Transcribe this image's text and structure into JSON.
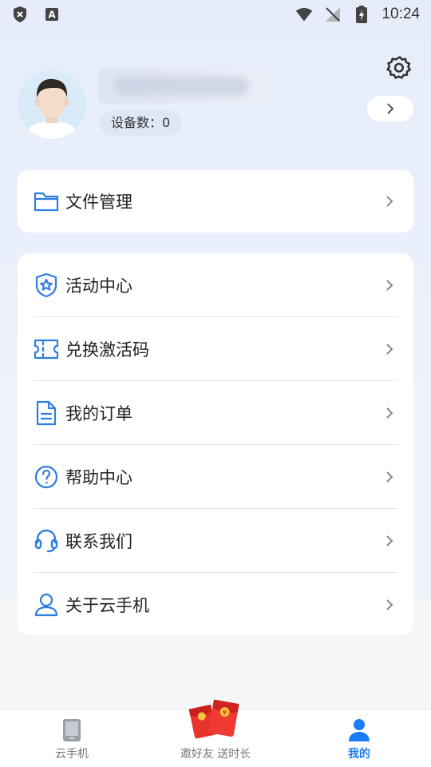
{
  "status_bar": {
    "time": "10:24"
  },
  "profile": {
    "device_count_label": "设备数：0"
  },
  "menu_file": {
    "label": "文件管理"
  },
  "menu_items": [
    {
      "label": "活动中心",
      "icon": "shield-star-icon"
    },
    {
      "label": "兑换激活码",
      "icon": "ticket-icon"
    },
    {
      "label": "我的订单",
      "icon": "document-icon"
    },
    {
      "label": "帮助中心",
      "icon": "question-icon"
    },
    {
      "label": "联系我们",
      "icon": "headset-icon"
    },
    {
      "label": "关于云手机",
      "icon": "user-icon"
    }
  ],
  "bottom_nav": {
    "cloud_phone": "云手机",
    "invite": "邀好友 送时长",
    "mine": "我的"
  },
  "colors": {
    "accent": "#1a7cf2",
    "icon_blue": "#2f7de1",
    "nav_inactive": "#777777"
  }
}
